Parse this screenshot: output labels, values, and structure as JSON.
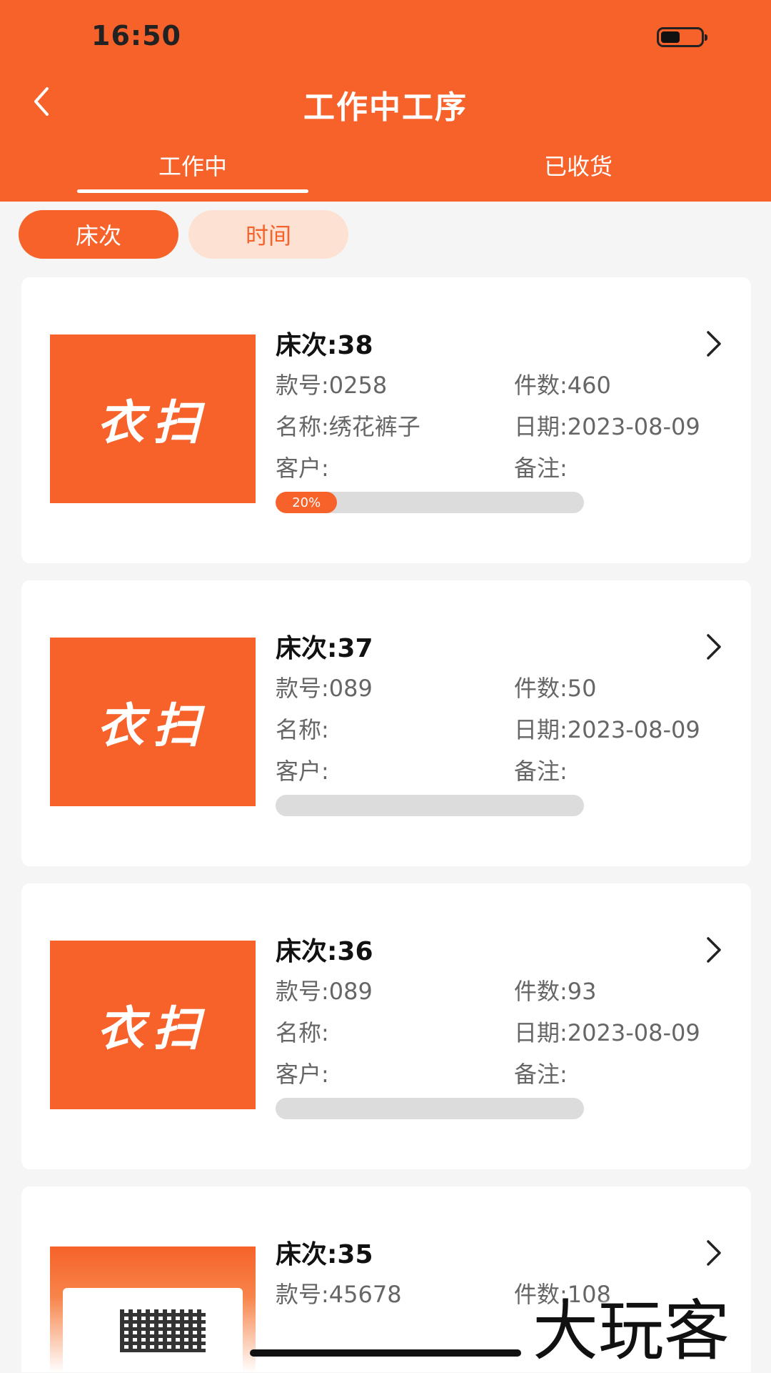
{
  "status_bar": {
    "time": "16:50"
  },
  "header": {
    "title": "工作中工序",
    "tabs": [
      {
        "label": "工作中",
        "active": true
      },
      {
        "label": "已收货",
        "active": false
      }
    ]
  },
  "filters": [
    {
      "label": "床次",
      "active": true
    },
    {
      "label": "时间",
      "active": false
    }
  ],
  "thumbnail_brand": "衣扫",
  "cards": [
    {
      "bed": "床次:38",
      "style": "款号:0258",
      "count": "件数:460",
      "name": "名称:绣花裤子",
      "date": "日期:2023-08-09",
      "customer": "客户:",
      "note": "备注:",
      "progress": 0.2,
      "progress_label": "20%"
    },
    {
      "bed": "床次:37",
      "style": "款号:089",
      "count": "件数:50",
      "name": "名称:",
      "date": "日期:2023-08-09",
      "customer": "客户:",
      "note": "备注:",
      "progress": 0
    },
    {
      "bed": "床次:36",
      "style": "款号:089",
      "count": "件数:93",
      "name": "名称:",
      "date": "日期:2023-08-09",
      "customer": "客户:",
      "note": "备注:",
      "progress": 0
    },
    {
      "bed": "床次:35",
      "style": "款号:45678",
      "count": "件数:108"
    }
  ],
  "watermark": "大玩客",
  "colors": {
    "accent": "#f6622a",
    "accent_light": "#fde2d4",
    "track": "#dcdcdc"
  }
}
